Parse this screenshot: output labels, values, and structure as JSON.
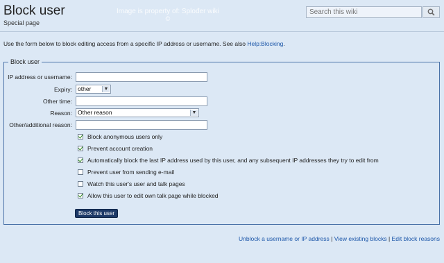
{
  "header": {
    "title": "Block user",
    "subtitle": "Special page",
    "watermark_line1": "Image is property of: Splođer wiki",
    "watermark_line2": "©"
  },
  "search": {
    "placeholder": "Search this wiki"
  },
  "intro": {
    "text": "Use the form below to block editing access from a specific IP address or username. See also ",
    "link": "Help:Blocking",
    "end": "."
  },
  "form": {
    "legend": "Block user",
    "ip_label": "IP address or username:",
    "ip_value": "",
    "expiry_label": "Expiry:",
    "expiry_value": "other",
    "other_time_label": "Other time:",
    "other_time_value": "",
    "reason_label": "Reason:",
    "reason_value": "Other reason",
    "other_reason_label": "Other/additional reason:",
    "other_reason_value": "",
    "checkboxes": [
      {
        "label": "Block anonymous users only",
        "checked": true
      },
      {
        "label": "Prevent account creation",
        "checked": true
      },
      {
        "label": "Automatically block the last IP address used by this user, and any subsequent IP addresses they try to edit from",
        "checked": true
      },
      {
        "label": "Prevent user from sending e-mail",
        "checked": false
      },
      {
        "label": "Watch this user's user and talk pages",
        "checked": false
      },
      {
        "label": "Allow this user to edit own talk page while blocked",
        "checked": true
      }
    ],
    "submit_label": "Block this user"
  },
  "footer": {
    "link1": "Unblock a username or IP address",
    "sep": " | ",
    "link2": "View existing blocks",
    "link3": "Edit block reasons"
  }
}
